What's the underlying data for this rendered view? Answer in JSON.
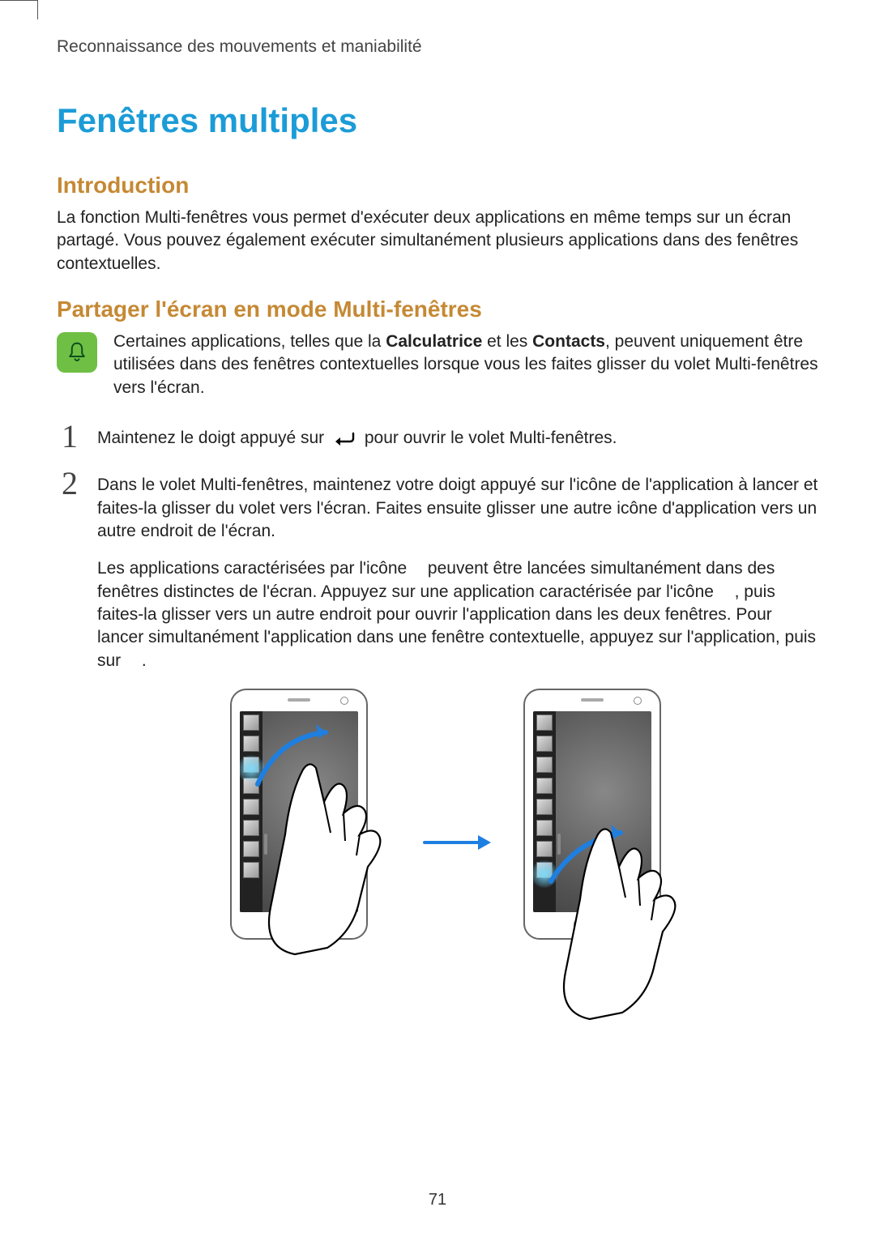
{
  "breadcrumb": "Reconnaissance des mouvements et maniabilité",
  "title": "Fenêtres multiples",
  "section_intro_heading": "Introduction",
  "section_intro_body": "La fonction Multi-fenêtres vous permet d'exécuter deux applications en même temps sur un écran partagé. Vous pouvez également exécuter simultanément plusieurs applications dans des fenêtres contextuelles.",
  "section_split_heading": "Partager l'écran en mode Multi-fenêtres",
  "note": {
    "pre": "Certaines applications, telles que la ",
    "bold1": "Calculatrice",
    "mid": " et les ",
    "bold2": "Contacts",
    "post": ", peuvent uniquement être utilisées dans des fenêtres contextuelles lorsque vous les faites glisser du volet Multi-fenêtres vers l'écran."
  },
  "steps": {
    "s1": {
      "num": "1",
      "pre": "Maintenez le doigt appuyé sur ",
      "post": " pour ouvrir le volet Multi-fenêtres."
    },
    "s2": {
      "num": "2",
      "text": "Dans le volet Multi-fenêtres, maintenez votre doigt appuyé sur l'icône de l'application à lancer et faites-la glisser du volet vers l'écran. Faites ensuite glisser une autre icône d'application vers un autre endroit de l'écran."
    },
    "extra": {
      "p1a": "Les applications caractérisées par l'icône ",
      "p1b": " peuvent être lancées simultanément dans des fenêtres distinctes de l'écran. Appuyez sur une application caractérisée par l'icône ",
      "p1c": ", puis faites-la glisser vers un autre endroit pour ouvrir l'application dans les deux fenêtres. Pour lancer simultanément l'application dans une fenêtre contextuelle, appuyez sur l'application, puis sur ",
      "p1d": "."
    }
  },
  "page_number": "71"
}
